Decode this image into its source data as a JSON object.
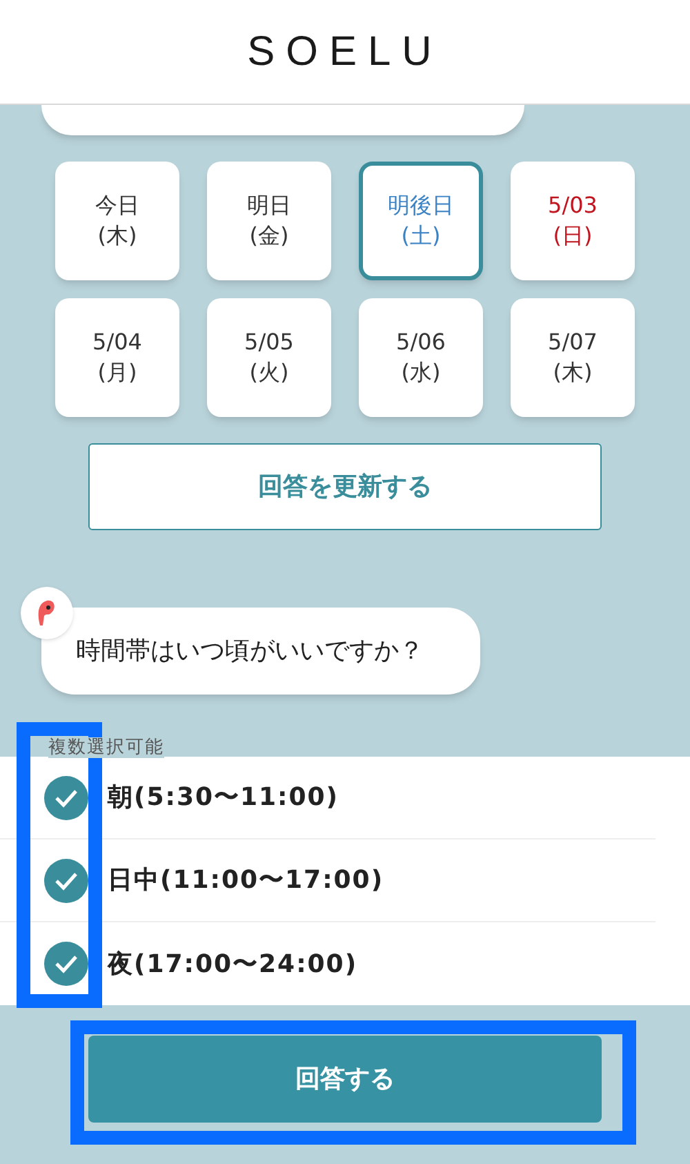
{
  "header": {
    "logo": "SOELU"
  },
  "dates": [
    {
      "day": "今日",
      "weekday": "(木)",
      "selected": false,
      "holiday": false
    },
    {
      "day": "明日",
      "weekday": "(金)",
      "selected": false,
      "holiday": false
    },
    {
      "day": "明後日",
      "weekday": "(土)",
      "selected": true,
      "holiday": false
    },
    {
      "day": "5/03",
      "weekday": "(日)",
      "selected": false,
      "holiday": true
    },
    {
      "day": "5/04",
      "weekday": "(月)",
      "selected": false,
      "holiday": false
    },
    {
      "day": "5/05",
      "weekday": "(火)",
      "selected": false,
      "holiday": false
    },
    {
      "day": "5/06",
      "weekday": "(水)",
      "selected": false,
      "holiday": false
    },
    {
      "day": "5/07",
      "weekday": "(木)",
      "selected": false,
      "holiday": false
    }
  ],
  "update_button": "回答を更新する",
  "question": "時間帯はいつ頃がいいですか？",
  "hint": "複数選択可能",
  "options": [
    {
      "label": "朝(5:30〜11:00)",
      "checked": true
    },
    {
      "label": "日中(11:00〜17:00)",
      "checked": true
    },
    {
      "label": "夜(17:00〜24:00)",
      "checked": true
    }
  ],
  "submit_button": "回答する"
}
